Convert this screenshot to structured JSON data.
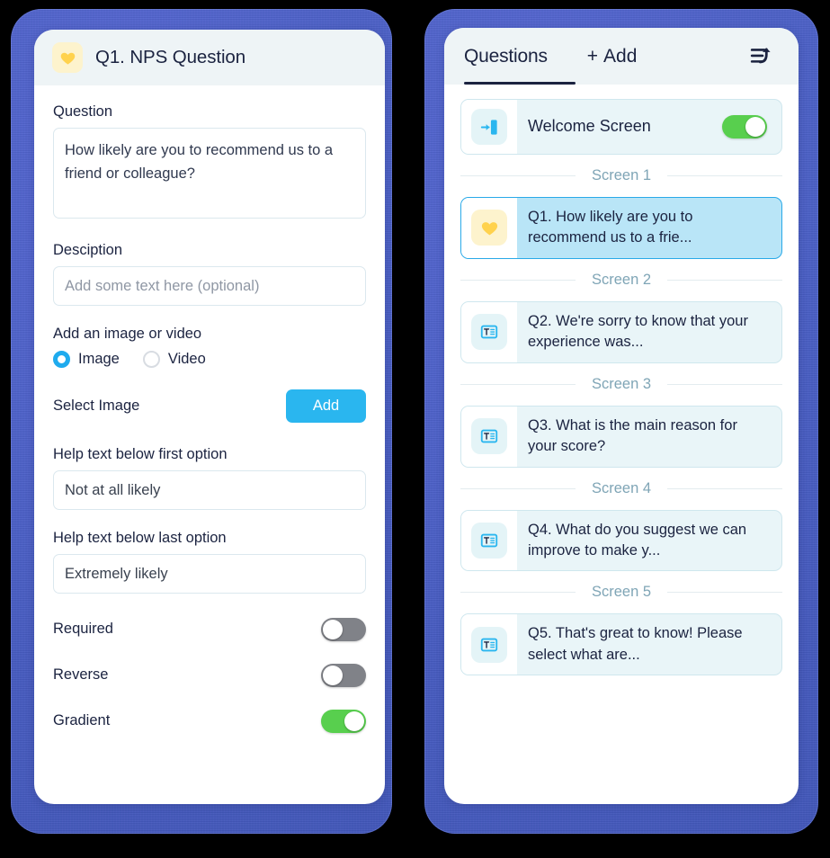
{
  "editor": {
    "header": {
      "icon": "heart-icon",
      "title": "Q1. NPS Question"
    },
    "question": {
      "label": "Question",
      "value": "How likely are you to recommend us to a friend or colleague?"
    },
    "description": {
      "label": "Desciption",
      "placeholder": "Add some text here (optional)",
      "value": ""
    },
    "media": {
      "label": "Add an image or video",
      "options": [
        {
          "label": "Image",
          "selected": true
        },
        {
          "label": "Video",
          "selected": false
        }
      ],
      "select_label": "Select Image",
      "add_button": "Add"
    },
    "help_first": {
      "label": "Help text below first option",
      "value": "Not at all likely"
    },
    "help_last": {
      "label": "Help text below last option",
      "value": "Extremely likely"
    },
    "toggles": [
      {
        "label": "Required",
        "state": "off"
      },
      {
        "label": "Reverse",
        "state": "off"
      },
      {
        "label": "Gradient",
        "state": "on"
      }
    ]
  },
  "panel": {
    "tabs": {
      "questions": "Questions",
      "add_plus": "+",
      "add": "Add",
      "history_icon": "list-undo-icon"
    },
    "welcome": {
      "icon": "enter-door-icon",
      "label": "Welcome Screen",
      "toggle_state": "on"
    },
    "separators": [
      "Screen 1",
      "Screen 2",
      "Screen 3",
      "Screen 4",
      "Screen 5"
    ],
    "questions": [
      {
        "icon": "heart-icon",
        "text": "Q1. How likely are you to recommend us to a frie...",
        "selected": true
      },
      {
        "icon": "text-box-icon",
        "text": "Q2. We're sorry to know that your experience was...",
        "selected": false
      },
      {
        "icon": "text-box-icon",
        "text": "Q3. What is the main reason for your score?",
        "selected": false
      },
      {
        "icon": "text-box-icon",
        "text": "Q4. What do you suggest we can improve to make y...",
        "selected": false
      },
      {
        "icon": "text-box-icon",
        "text": "Q5. That's great to know! Please select what are...",
        "selected": false
      }
    ]
  },
  "colors": {
    "frame_blue": "#4a5fc4",
    "accent_cyan": "#2ab6ef",
    "toggle_on_green": "#58cf4e",
    "toggle_off_gray": "#808288",
    "selected_row_blue": "#b9e5f7",
    "row_teal": "#e9f5f8",
    "heart_yellow": "#ffd24d",
    "header_gray": "#eef4f6",
    "text_dark": "#1b2340",
    "separator_text": "#7fa5b6"
  }
}
